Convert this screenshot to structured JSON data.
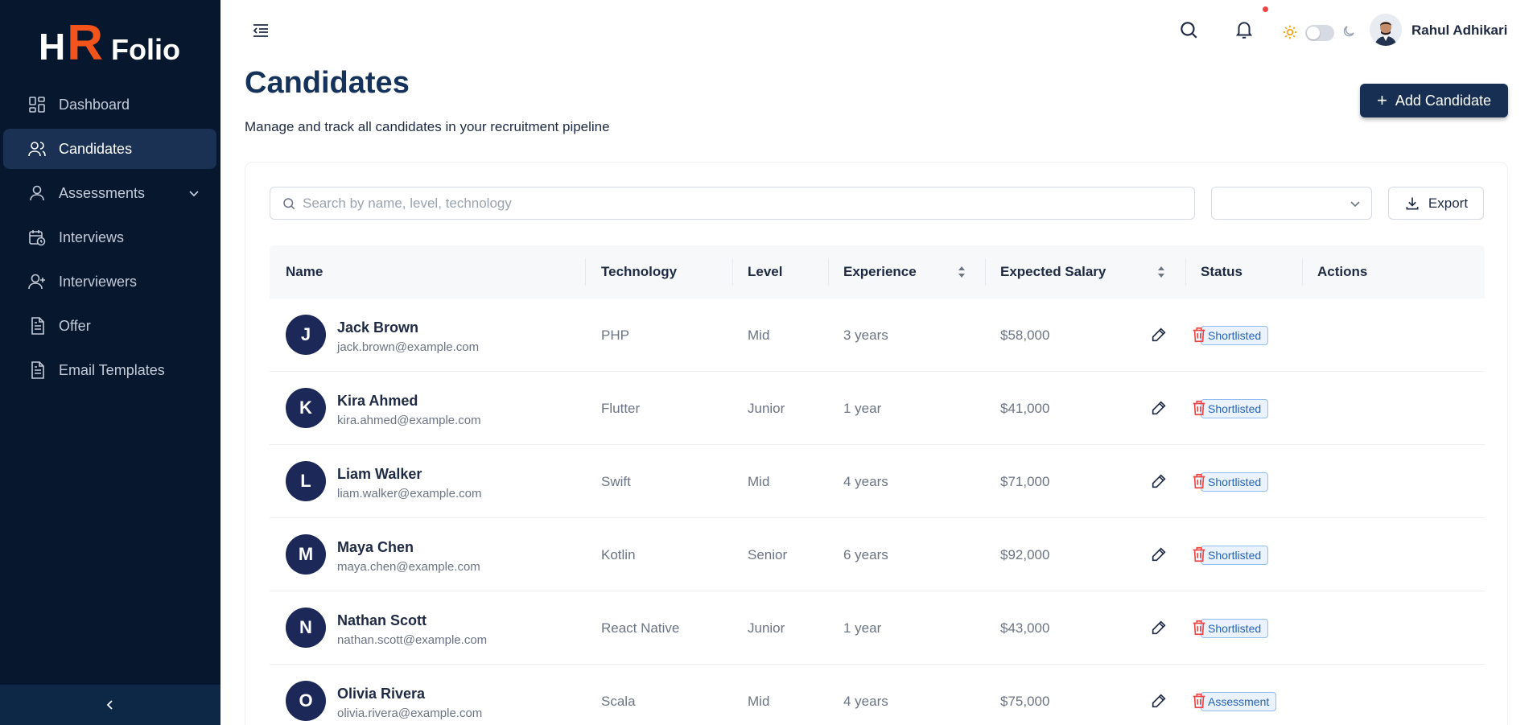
{
  "brand": {
    "h": "H",
    "r": "R",
    "folio": "Folio"
  },
  "sidebar": {
    "items": [
      {
        "label": "Dashboard",
        "icon": "dashboard-icon"
      },
      {
        "label": "Candidates",
        "icon": "users-icon",
        "active": true
      },
      {
        "label": "Assessments",
        "icon": "user-icon",
        "has_children": true
      },
      {
        "label": "Interviews",
        "icon": "calendar-clock-icon"
      },
      {
        "label": "Interviewers",
        "icon": "user-plus-icon"
      },
      {
        "label": "Offer",
        "icon": "document-icon"
      },
      {
        "label": "Email Templates",
        "icon": "document-icon"
      }
    ]
  },
  "header": {
    "user_name": "Rahul Adhikari",
    "theme": "light"
  },
  "page": {
    "title": "Candidates",
    "subtitle": "Manage and track all candidates in your recruitment pipeline",
    "add_button": "Add Candidate"
  },
  "toolbar": {
    "search_placeholder": "Search by name, level, technology",
    "filter_value": "",
    "export_label": "Export"
  },
  "table": {
    "columns": {
      "name": "Name",
      "technology": "Technology",
      "level": "Level",
      "experience": "Experience",
      "salary": "Expected Salary",
      "status": "Status",
      "actions": "Actions"
    },
    "rows": [
      {
        "initial": "J",
        "name": "Jack Brown",
        "email": "jack.brown@example.com",
        "technology": "PHP",
        "level": "Mid",
        "experience": "3 years",
        "salary": "$58,000",
        "status": "Shortlisted"
      },
      {
        "initial": "K",
        "name": "Kira Ahmed",
        "email": "kira.ahmed@example.com",
        "technology": "Flutter",
        "level": "Junior",
        "experience": "1 year",
        "salary": "$41,000",
        "status": "Shortlisted"
      },
      {
        "initial": "L",
        "name": "Liam Walker",
        "email": "liam.walker@example.com",
        "technology": "Swift",
        "level": "Mid",
        "experience": "4 years",
        "salary": "$71,000",
        "status": "Shortlisted"
      },
      {
        "initial": "M",
        "name": "Maya Chen",
        "email": "maya.chen@example.com",
        "technology": "Kotlin",
        "level": "Senior",
        "experience": "6 years",
        "salary": "$92,000",
        "status": "Shortlisted"
      },
      {
        "initial": "N",
        "name": "Nathan Scott",
        "email": "nathan.scott@example.com",
        "technology": "React Native",
        "level": "Junior",
        "experience": "1 year",
        "salary": "$43,000",
        "status": "Shortlisted"
      },
      {
        "initial": "O",
        "name": "Olivia Rivera",
        "email": "olivia.rivera@example.com",
        "technology": "Scala",
        "level": "Mid",
        "experience": "4 years",
        "salary": "$75,000",
        "status": "Assessment"
      }
    ]
  },
  "colors": {
    "sidebar_bg": "#07172e",
    "active_item": "#1b3154",
    "accent": "#172f53",
    "logo_r": "#f2541b",
    "delete": "#ef4444",
    "badge_text": "#2463b8"
  }
}
